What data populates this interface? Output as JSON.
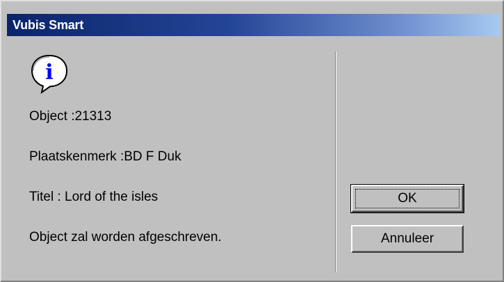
{
  "window": {
    "title": "Vubis Smart"
  },
  "icon": {
    "name": "information-icon",
    "glyph": "i",
    "colors": {
      "bubble": "#ffffff",
      "glyph": "#0000ff",
      "outline": "#000000"
    }
  },
  "message": {
    "lines": [
      "Object :21313",
      "Plaatskenmerk :BD F Duk",
      "Titel : Lord of the isles",
      "Object zal worden afgeschreven."
    ]
  },
  "buttons": {
    "ok_label": "OK",
    "cancel_label": "Annuleer"
  },
  "colors": {
    "dialog_bg": "#c0c0c0",
    "titlebar_start": "#0a246a",
    "titlebar_end": "#a6caf0",
    "title_text": "#ffffff"
  }
}
